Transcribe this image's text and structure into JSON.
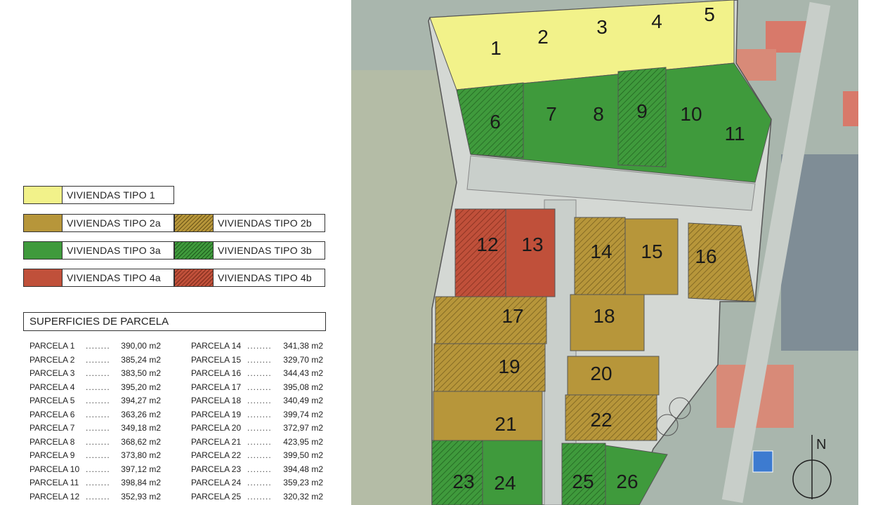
{
  "legend": {
    "items": [
      {
        "label": "VIVIENDAS TIPO 1"
      },
      {
        "label": "VIVIENDAS TIPO 2a"
      },
      {
        "label": "VIVIENDAS TIPO 2b"
      },
      {
        "label": "VIVIENDAS TIPO 3a"
      },
      {
        "label": "VIVIENDAS TIPO 3b"
      },
      {
        "label": "VIVIENDAS TIPO 4a"
      },
      {
        "label": "VIVIENDAS TIPO 4b"
      }
    ]
  },
  "colors": {
    "tipo1": "#f2f28a",
    "tipo2": "#b7963a",
    "tipo3": "#3f9a3c",
    "tipo4": "#c0503a",
    "road": "#c9cfcb",
    "aerial": "#9fb0a8"
  },
  "surfaces": {
    "title": "SUPERFICIES DE PARCELA",
    "dots": "........",
    "left": [
      {
        "name": "PARCELA 1",
        "area": "390,00 m2"
      },
      {
        "name": "PARCELA 2",
        "area": "385,24 m2"
      },
      {
        "name": "PARCELA 3",
        "area": "383,50 m2"
      },
      {
        "name": "PARCELA 4",
        "area": "395,20 m2"
      },
      {
        "name": "PARCELA 5",
        "area": "394,27 m2"
      },
      {
        "name": "PARCELA 6",
        "area": "363,26 m2"
      },
      {
        "name": "PARCELA 7",
        "area": "349,18 m2"
      },
      {
        "name": "PARCELA 8",
        "area": "368,62 m2"
      },
      {
        "name": "PARCELA 9",
        "area": "373,80 m2"
      },
      {
        "name": "PARCELA 10",
        "area": "397,12 m2"
      },
      {
        "name": "PARCELA 11",
        "area": "398,84 m2"
      },
      {
        "name": "PARCELA 12",
        "area": "352,93 m2"
      }
    ],
    "right": [
      {
        "name": "PARCELA 14",
        "area": "341,38 m2"
      },
      {
        "name": "PARCELA 15",
        "area": "329,70 m2"
      },
      {
        "name": "PARCELA 16",
        "area": "344,43 m2"
      },
      {
        "name": "PARCELA 17",
        "area": "395,08 m2"
      },
      {
        "name": "PARCELA 18",
        "area": "340,49 m2"
      },
      {
        "name": "PARCELA 19",
        "area": "399,74 m2"
      },
      {
        "name": "PARCELA 20",
        "area": "372,97 m2"
      },
      {
        "name": "PARCELA 21",
        "area": "423,95 m2"
      },
      {
        "name": "PARCELA 22",
        "area": "399,50 m2"
      },
      {
        "name": "PARCELA 23",
        "area": "394,48 m2"
      },
      {
        "name": "PARCELA 24",
        "area": "359,23 m2"
      },
      {
        "name": "PARCELA 25",
        "area": "320,32 m2"
      }
    ]
  },
  "map": {
    "lots": [
      {
        "n": "1",
        "type": "1"
      },
      {
        "n": "2",
        "type": "1"
      },
      {
        "n": "3",
        "type": "1"
      },
      {
        "n": "4",
        "type": "1"
      },
      {
        "n": "5",
        "type": "1"
      },
      {
        "n": "6",
        "type": "3b"
      },
      {
        "n": "7",
        "type": "3a"
      },
      {
        "n": "8",
        "type": "3a"
      },
      {
        "n": "9",
        "type": "3b"
      },
      {
        "n": "10",
        "type": "3a"
      },
      {
        "n": "11",
        "type": "3a"
      },
      {
        "n": "12",
        "type": "4b"
      },
      {
        "n": "13",
        "type": "4a"
      },
      {
        "n": "14",
        "type": "2b"
      },
      {
        "n": "15",
        "type": "2a"
      },
      {
        "n": "16",
        "type": "2b"
      },
      {
        "n": "17",
        "type": "2b"
      },
      {
        "n": "18",
        "type": "2a"
      },
      {
        "n": "19",
        "type": "2b"
      },
      {
        "n": "20",
        "type": "2a"
      },
      {
        "n": "21",
        "type": "2a"
      },
      {
        "n": "22",
        "type": "2b"
      },
      {
        "n": "23",
        "type": "3b"
      },
      {
        "n": "24",
        "type": "3a"
      },
      {
        "n": "25",
        "type": "3b"
      },
      {
        "n": "26",
        "type": "3a"
      }
    ],
    "north": "N"
  }
}
